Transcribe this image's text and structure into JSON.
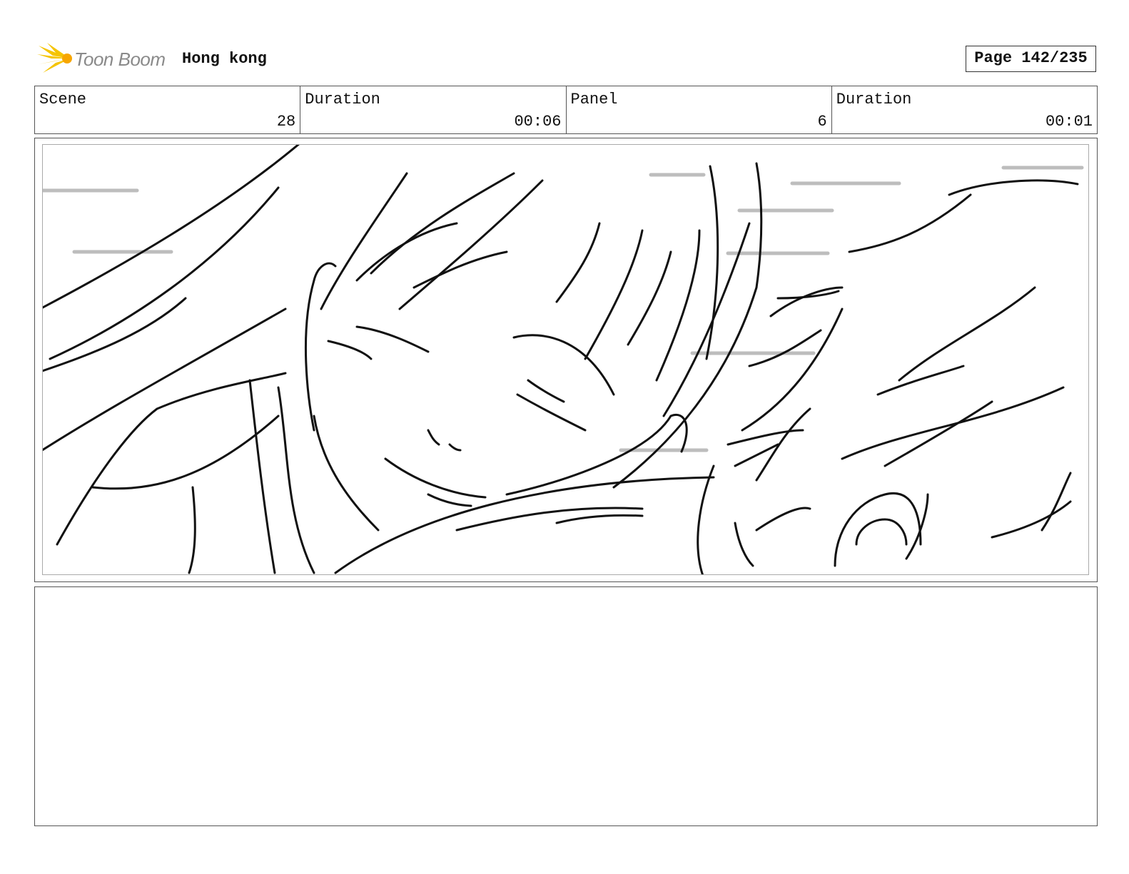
{
  "header": {
    "brand": "Toon Boom",
    "project_title": "Hong kong",
    "page_label": "Page 142/235"
  },
  "info": {
    "scene_label": "Scene",
    "scene_value": "28",
    "scene_duration_label": "Duration",
    "scene_duration_value": "00:06",
    "panel_label": "Panel",
    "panel_value": "6",
    "panel_duration_label": "Duration",
    "panel_duration_value": "00:01"
  },
  "colors": {
    "logo_accent": "#f5c400",
    "border": "#555555"
  }
}
